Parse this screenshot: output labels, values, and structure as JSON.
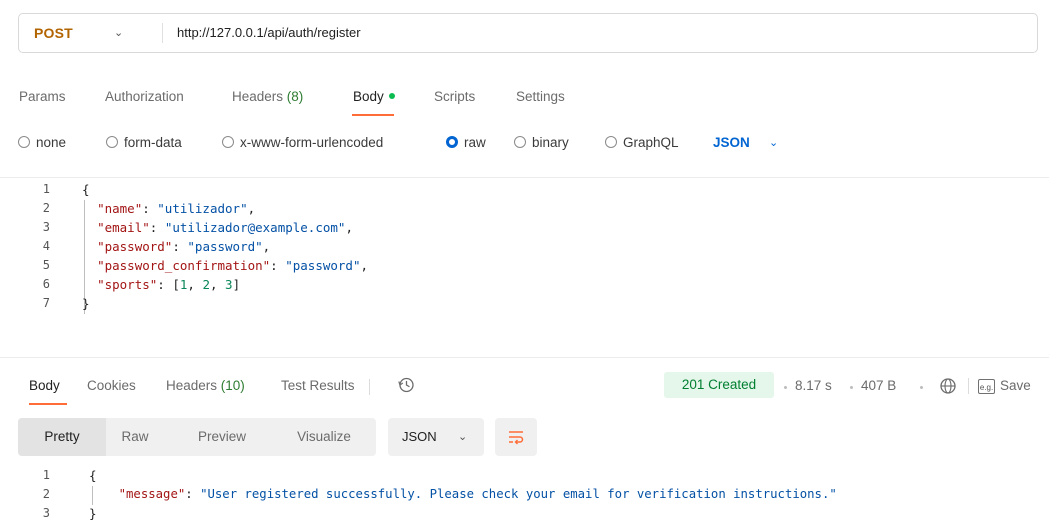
{
  "request": {
    "method": "POST",
    "url": "http://127.0.0.1/api/auth/register",
    "tabs": [
      {
        "label": "Params"
      },
      {
        "label": "Authorization"
      },
      {
        "label": "Headers",
        "count": "(8)"
      },
      {
        "label": "Body"
      },
      {
        "label": "Scripts"
      },
      {
        "label": "Settings"
      }
    ],
    "body_types": [
      "none",
      "form-data",
      "x-www-form-urlencoded",
      "raw",
      "binary",
      "GraphQL"
    ],
    "selected_body_type": "raw",
    "body_language": "JSON",
    "body_lines": {
      "l1": "{",
      "l2_key": "\"name\"",
      "l2_val": "\"utilizador\"",
      "l3_key": "\"email\"",
      "l3_val": "\"utilizador@example.com\"",
      "l4_key": "\"password\"",
      "l4_val": "\"password\"",
      "l5_key": "\"password_confirmation\"",
      "l5_val": "\"password\"",
      "l6_key": "\"sports\"",
      "l6_n1": "1",
      "l6_n2": "2",
      "l6_n3": "3",
      "l7": "}"
    },
    "line_numbers": [
      "1",
      "2",
      "3",
      "4",
      "5",
      "6",
      "7"
    ]
  },
  "response": {
    "tabs": [
      {
        "label": "Body"
      },
      {
        "label": "Cookies"
      },
      {
        "label": "Headers",
        "count": "(10)"
      },
      {
        "label": "Test Results"
      }
    ],
    "status": "201 Created",
    "time": "8.17 s",
    "size": "407 B",
    "save_label": "Save",
    "eg_label": "e.g.",
    "views": [
      "Pretty",
      "Raw",
      "Preview",
      "Visualize"
    ],
    "language": "JSON",
    "body_lines": {
      "l1": "{",
      "l2_key": "\"message\"",
      "l2_val": "\"User registered successfully. Please check your email for verification instructions.\"",
      "l3": "}"
    },
    "line_numbers": [
      "1",
      "2",
      "3"
    ]
  },
  "icons": {
    "method_chevron": "chevron-down-icon",
    "history": "history-icon",
    "globe": "globe-icon",
    "wrap": "wrap-lines-icon"
  },
  "colors": {
    "method": "#b26400",
    "accent_tab": "#ff6c37",
    "status_bg": "#e5f6ea",
    "status_text": "#007f31",
    "selection_blue": "#0265d2"
  }
}
